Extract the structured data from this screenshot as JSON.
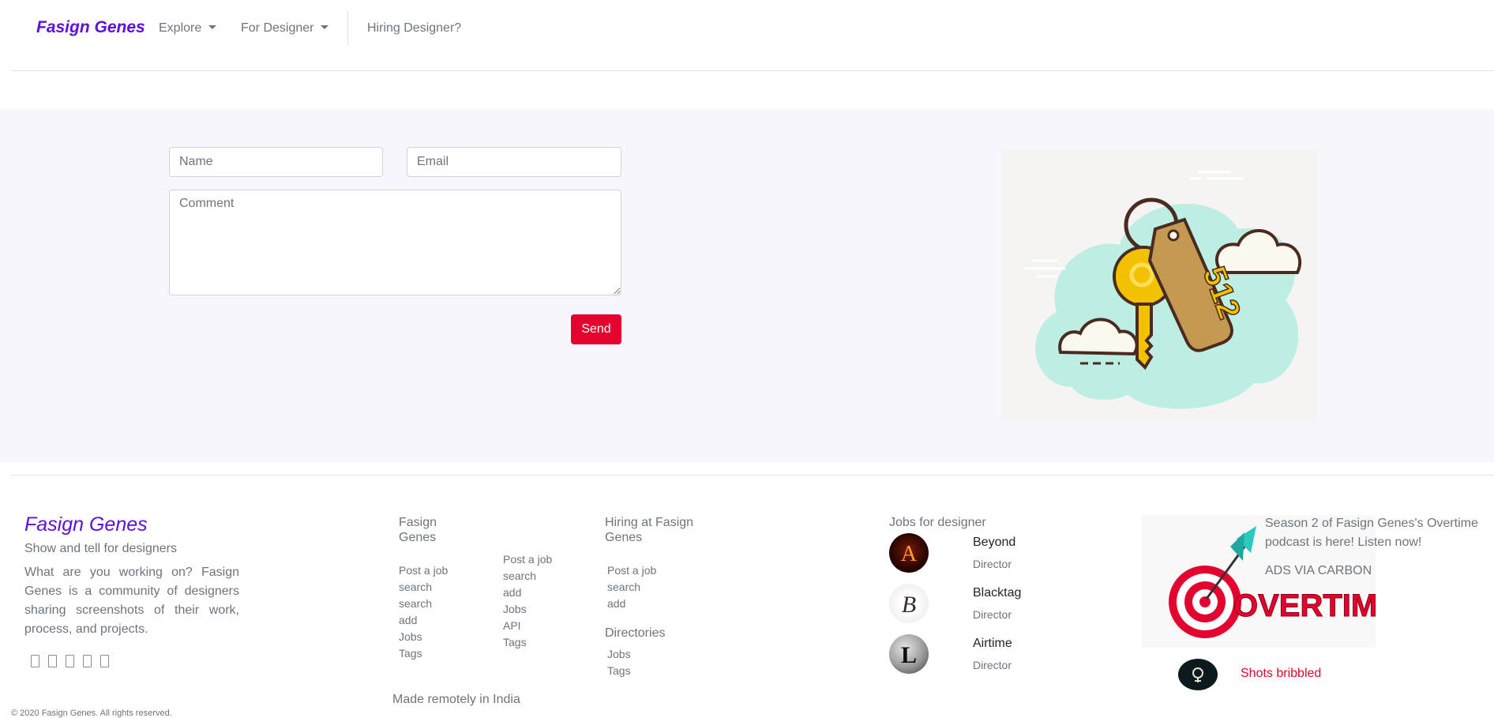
{
  "nav": {
    "brand": "Fasign Genes",
    "explore": "Explore",
    "for_designer": "For Designer",
    "hiring": "Hiring Designer?"
  },
  "contact_form": {
    "name_placeholder": "Name",
    "email_placeholder": "Email",
    "comment_placeholder": "Comment",
    "send_label": "Send",
    "illustration_tag": "512"
  },
  "footer": {
    "brand": "Fasign Genes",
    "tagline": "Show and tell for designers",
    "about": "What are you working on? Fasign Genes is a community of designers sharing screenshots of their work, process, and projects.",
    "social_icons": [
      "twitter-icon",
      "facebook-icon",
      "instagram-icon",
      "pinterest-icon",
      "dribbble-icon"
    ],
    "col1": {
      "heading": "Fasign Genes",
      "links": [
        "Post a job",
        "search",
        "search",
        "add",
        "Jobs",
        "Tags"
      ]
    },
    "col2": {
      "links": [
        "Post a job",
        "search",
        "add",
        "Jobs",
        "API",
        "Tags"
      ]
    },
    "col3": {
      "heading": "Hiring at Fasign Genes",
      "links": [
        "Post a job",
        "search",
        "add"
      ],
      "sub_heading": "Directories",
      "sub_links": [
        "Jobs",
        "Tags"
      ]
    },
    "jobs": {
      "heading": "Jobs for designer",
      "items": [
        {
          "name": "Beyond",
          "role": "Director",
          "letter": "A"
        },
        {
          "name": "Blacktag",
          "role": "Director",
          "letter": "B"
        },
        {
          "name": "Airtime",
          "role": "Director",
          "letter": "L"
        }
      ]
    },
    "ad": {
      "text": "Season 2 of Fasign Genes's Overtime podcast is here! Listen now!",
      "via": "ADS VIA CARBON",
      "logo_word": "OVERTIME"
    },
    "shots": "Shots bribbled",
    "made": "Made remotely in India",
    "copyright": "© 2020 Fasign Genes. All rights reserved."
  }
}
